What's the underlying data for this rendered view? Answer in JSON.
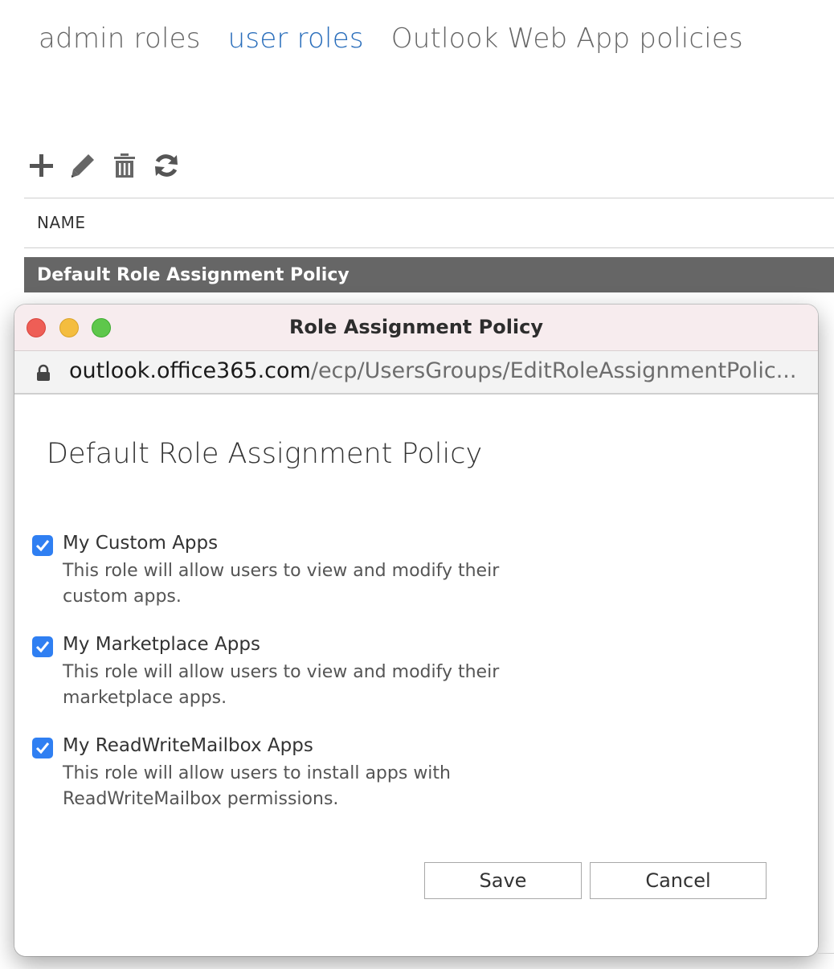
{
  "tabs": [
    {
      "label": "admin roles",
      "active": false
    },
    {
      "label": "user roles",
      "active": true
    },
    {
      "label": "Outlook Web App policies",
      "active": false
    }
  ],
  "toolbar": {
    "icons": [
      "add-icon",
      "edit-icon",
      "delete-icon",
      "refresh-icon"
    ]
  },
  "list": {
    "header": "NAME",
    "rows": [
      "Default Role Assignment Policy"
    ]
  },
  "popup": {
    "window_title": "Role Assignment Policy",
    "url_host": "outlook.office365.com",
    "url_path": "/ecp/UsersGroups/EditRoleAssignmentPolic...",
    "policy_title": "Default Role Assignment Policy",
    "roles": [
      {
        "name": "My Custom Apps",
        "description": "This role will allow users to view and modify their custom apps.",
        "checked": true
      },
      {
        "name": "My Marketplace Apps",
        "description": "This role will allow users to view and modify their marketplace apps.",
        "checked": true
      },
      {
        "name": "My ReadWriteMailbox Apps",
        "description": "This role will allow users to install apps with ReadWriteMailbox permissions.",
        "checked": true
      }
    ],
    "save_label": "Save",
    "cancel_label": "Cancel"
  },
  "colors": {
    "accent": "#2a6ebb",
    "checkbox": "#2f7ff2",
    "selected_row": "#666666"
  }
}
